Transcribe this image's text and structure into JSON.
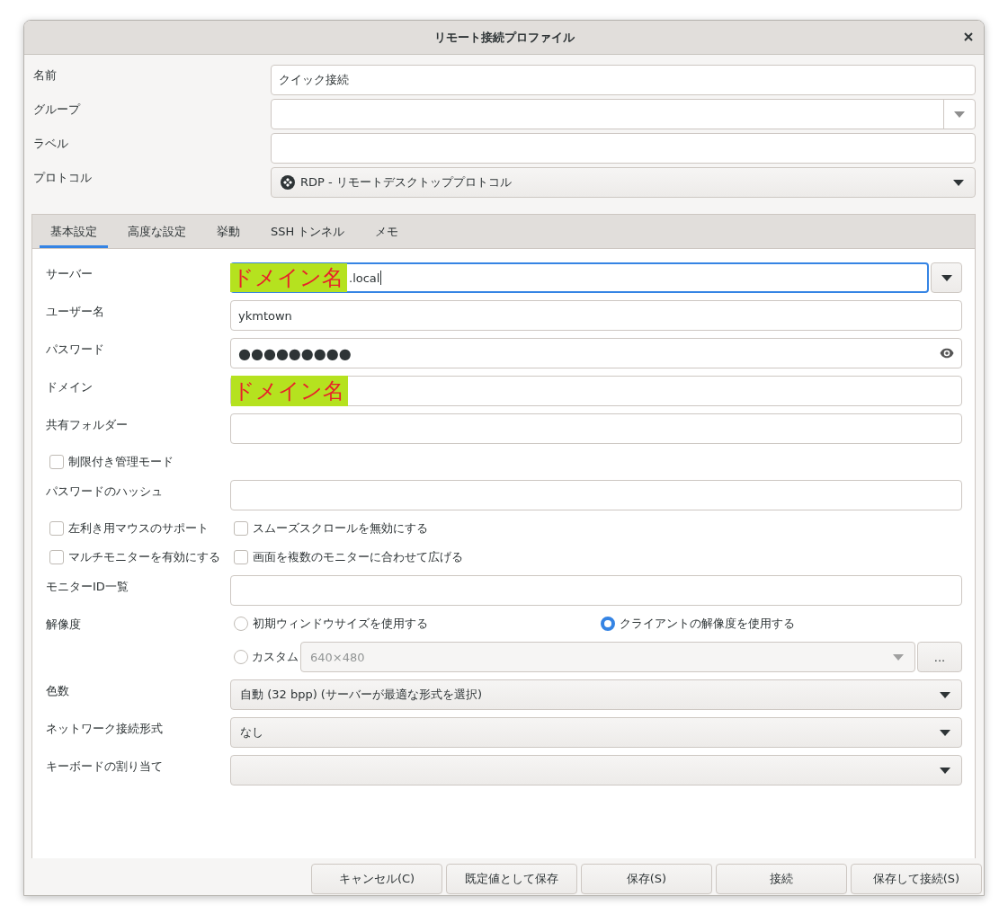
{
  "window": {
    "title": "リモート接続プロファイル"
  },
  "profile_fields": [
    {
      "kind": "text",
      "label": "名前",
      "value": "クイック接続"
    },
    {
      "kind": "combo",
      "label": "グループ"
    },
    {
      "kind": "text",
      "label": "ラベル"
    },
    {
      "kind": "dropdown",
      "label": "プロトコル",
      "value": "RDP - リモートデスクトッププロトコル"
    }
  ],
  "tabs": [
    {
      "label": "基本設定",
      "selected": true
    },
    {
      "label": "高度な設定",
      "selected": false
    },
    {
      "label": "挙動",
      "selected": false
    },
    {
      "label": "SSH トンネル",
      "selected": false
    },
    {
      "label": "メモ",
      "selected": false
    }
  ],
  "basic_settings": [
    {
      "kind": "combo",
      "label": "サーバー",
      "redaction": "ドメイン名",
      "value": ".local",
      "focused": true
    },
    {
      "kind": "text",
      "label": "ユーザー名",
      "value": "ykmtown"
    },
    {
      "kind": "password",
      "label": "パスワード",
      "value": "●●●●●●●●●"
    },
    {
      "kind": "text",
      "label": "ドメイン",
      "redaction": "ドメイン名"
    },
    {
      "kind": "text",
      "label": "共有フォルダー"
    },
    {
      "kind": "checks",
      "items": [
        {
          "label": "制限付き管理モード",
          "checked": false
        }
      ]
    },
    {
      "kind": "text",
      "label": "パスワードのハッシュ"
    },
    {
      "kind": "checks",
      "items": [
        {
          "label": "左利き用マウスのサポート",
          "checked": false
        },
        {
          "label": "スムーズスクロールを無効にする",
          "checked": false
        }
      ]
    },
    {
      "kind": "checks",
      "items": [
        {
          "label": "マルチモニターを有効にする",
          "checked": false
        },
        {
          "label": "画面を複数のモニターに合わせて広げる",
          "checked": false
        }
      ]
    },
    {
      "kind": "text",
      "label": "モニターID一覧"
    },
    {
      "kind": "resolution",
      "label": "解像度",
      "options": [
        {
          "label": "初期ウィンドウサイズを使用する",
          "selected": false
        },
        {
          "label": "クライアントの解像度を使用する",
          "selected": true
        }
      ],
      "custom": {
        "label": "カスタム",
        "selected": false,
        "value": "640×480",
        "button": "..."
      }
    },
    {
      "kind": "dropdown",
      "label": "色数",
      "value": "自動 (32 bpp) (サーバーが最適な形式を選択)"
    },
    {
      "kind": "dropdown",
      "label": "ネットワーク接続形式",
      "value": "なし"
    },
    {
      "kind": "dropdown",
      "label": "キーボードの割り当て"
    }
  ],
  "buttons": [
    "キャンセル(C)",
    "既定値として保存",
    "保存(S)",
    "接続",
    "保存して接続(S)"
  ]
}
